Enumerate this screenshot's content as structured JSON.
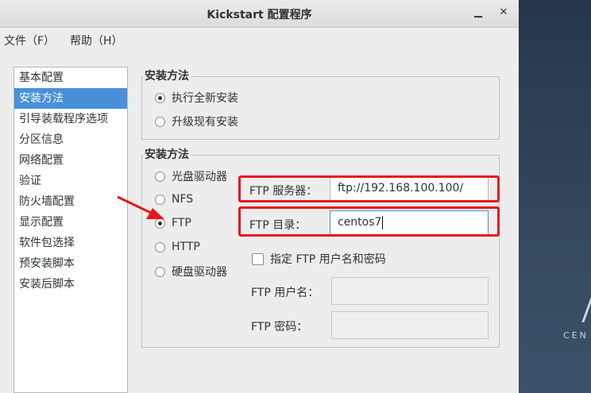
{
  "window": {
    "title": "Kickstart 配置程序",
    "minimize_icon": "minimize-icon",
    "close_icon": "close-icon"
  },
  "menu": {
    "file": "文件（F）",
    "help": "帮助（H）"
  },
  "sidebar": {
    "items": [
      {
        "label": "基本配置",
        "selected": false
      },
      {
        "label": "安装方法",
        "selected": true
      },
      {
        "label": "引导装载程序选项",
        "selected": false
      },
      {
        "label": "分区信息",
        "selected": false
      },
      {
        "label": "网络配置",
        "selected": false
      },
      {
        "label": "验证",
        "selected": false
      },
      {
        "label": "防火墙配置",
        "selected": false
      },
      {
        "label": "显示配置",
        "selected": false
      },
      {
        "label": "软件包选择",
        "selected": false
      },
      {
        "label": "预安装脚本",
        "selected": false
      },
      {
        "label": "安装后脚本",
        "selected": false
      }
    ]
  },
  "install_type": {
    "heading": "安装方法",
    "options": [
      {
        "label": "执行全新安装",
        "checked": true
      },
      {
        "label": "升级现有安装",
        "checked": false
      }
    ]
  },
  "install_method": {
    "heading": "安装方法",
    "options": [
      {
        "label": "光盘驱动器",
        "checked": false
      },
      {
        "label": "NFS",
        "checked": false
      },
      {
        "label": "FTP",
        "checked": true
      },
      {
        "label": "HTTP",
        "checked": false
      },
      {
        "label": "硬盘驱动器",
        "checked": false
      }
    ]
  },
  "ftp": {
    "server_label": "FTP 服务器：",
    "server_value": "ftp://192.168.100.100/",
    "dir_label": "FTP 目录：",
    "dir_value": "centos7",
    "auth_checkbox_label": "指定  FTP 用户名和密码",
    "auth_checked": false,
    "user_label": "FTP 用户名：",
    "user_value": "",
    "pass_label": "FTP 密码：",
    "pass_value": ""
  },
  "desktop": {
    "logo_text": "CEN"
  },
  "colors": {
    "selection": "#4a90d9",
    "annotation_red": "#e8141e"
  }
}
